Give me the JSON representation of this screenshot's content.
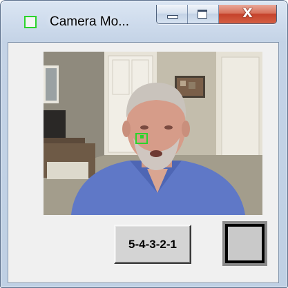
{
  "window": {
    "title": "Camera Mo...",
    "icon": "green-square-icon"
  },
  "caption_buttons": {
    "minimize_icon": "minimize-icon",
    "maximize_icon": "maximize-icon",
    "close_label": "X"
  },
  "content": {
    "video_feed": "webcam-view",
    "tracking_marker_color": "#2bd42b",
    "countdown_label": "5-4-3-2-1",
    "record_toggle_icon": "square-stop-icon"
  },
  "colors": {
    "accent_green": "#2bd42b",
    "close_red": "#c5422b",
    "panel_gray": "#f0f0f0"
  }
}
